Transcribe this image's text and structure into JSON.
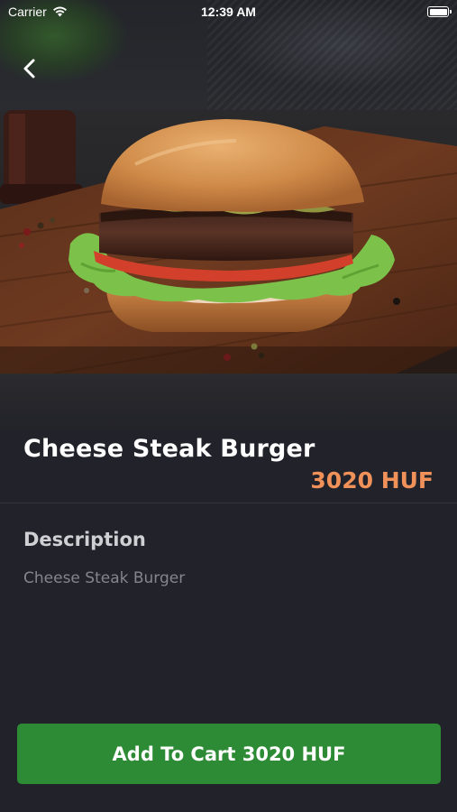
{
  "status_bar": {
    "carrier": "Carrier",
    "time": "12:39 AM",
    "battery_level": 1.0
  },
  "navigation": {
    "back_icon": "chevron-left-icon"
  },
  "product": {
    "title": "Cheese Steak Burger",
    "price": "3020 HUF",
    "description_heading": "Description",
    "description": "Cheese Steak Burger",
    "image": "burger-photo"
  },
  "cart": {
    "button_label": "Add To Cart 3020 HUF"
  },
  "colors": {
    "background": "#22222a",
    "price_accent": "#f0915a",
    "button_green": "#2e8b35"
  }
}
